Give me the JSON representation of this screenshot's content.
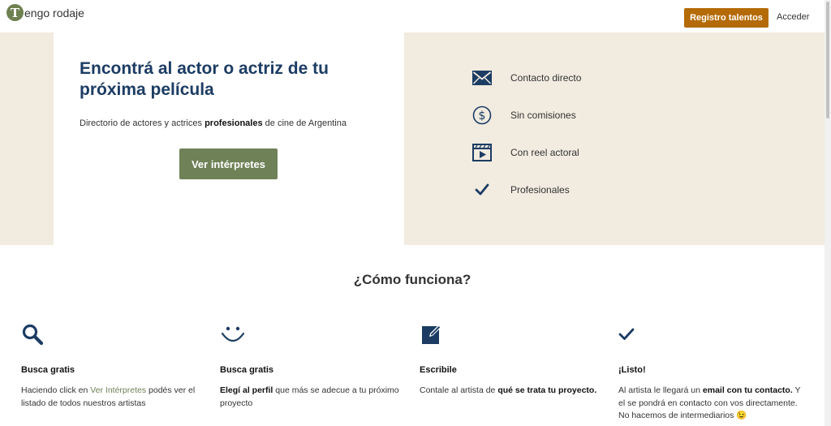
{
  "header": {
    "logo_letter": "T",
    "logo_text": "engo rodaje",
    "register_label": "Registro talentos",
    "login_label": "Acceder"
  },
  "hero": {
    "title": "Encontrá al actor o actriz de tu próxima película",
    "subtitle_pre": "Directorio de actores y actrices ",
    "subtitle_bold": "profesionales",
    "subtitle_post": " de cine de Argentina",
    "cta_label": "Ver intérpretes",
    "features": [
      {
        "label": "Contacto directo",
        "icon": "envelope-icon"
      },
      {
        "label": "Sin comisiones",
        "icon": "dollar-icon"
      },
      {
        "label": "Con reel actoral",
        "icon": "video-icon"
      },
      {
        "label": "Profesionales",
        "icon": "check-icon"
      }
    ]
  },
  "how": {
    "title": "¿Cómo funciona?",
    "steps": [
      {
        "icon": "search-icon",
        "title": "Busca gratis",
        "t1": "Haciendo click en ",
        "link": "Ver Intérpretes",
        "t2": " podés ver el listado de todos nuestros artistas"
      },
      {
        "icon": "smile-icon",
        "title": "Busca gratis",
        "bold": "Elegí al perfil",
        "t1": " que más se adecue a tu próximo proyecto"
      },
      {
        "icon": "edit-icon",
        "title": "Escribile",
        "t1": "Contale al artista de ",
        "bold": "qué se trata tu proyecto."
      },
      {
        "icon": "check-icon",
        "title": "¡Listo!",
        "t1": "Al artista le llegará un ",
        "bold": "email con tu contacto.",
        "t2": " Y el se pondrá en contacto con vos directamente. No hacemos de intermediarios",
        "emoji": "😉"
      }
    ]
  },
  "colors": {
    "accent_orange": "#b46a06",
    "accent_green": "#6f8257",
    "navy": "#1c3c63",
    "beige": "#f1ebe0"
  }
}
